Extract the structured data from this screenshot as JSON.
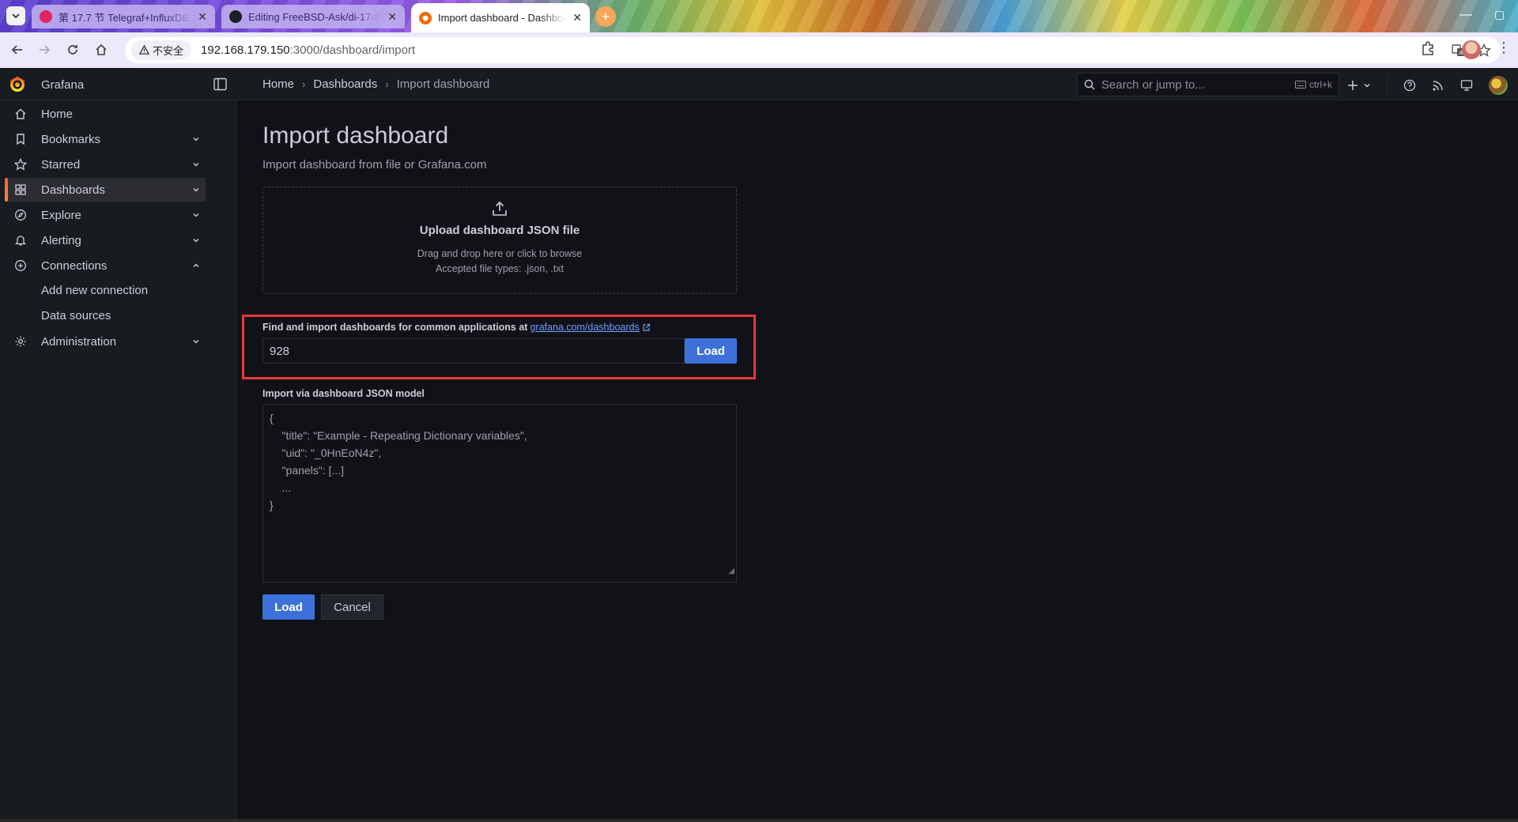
{
  "browser": {
    "tabs": [
      {
        "title": "第 17.7 节 Telegraf+InfluxDB",
        "favicon_color": "#e0245e"
      },
      {
        "title": "Editing FreeBSD-Ask/di-17-z",
        "favicon_color": "#1b1f23"
      },
      {
        "title": "Import dashboard - Dashboards",
        "favicon_color": "#f46800"
      }
    ],
    "new_tab": "+",
    "security_label": "不安全",
    "url_host": "192.168.179.150",
    "url_path": ":3000/dashboard/import"
  },
  "grafana": {
    "brand": "Grafana",
    "breadcrumb": [
      "Home",
      "Dashboards",
      "Import dashboard"
    ],
    "search_placeholder": "Search or jump to...",
    "search_shortcut": "ctrl+k",
    "nav": [
      {
        "label": "Home",
        "icon": "home-icon",
        "chevron": false
      },
      {
        "label": "Bookmarks",
        "icon": "bookmark-icon",
        "chevron": true
      },
      {
        "label": "Starred",
        "icon": "star-icon",
        "chevron": true
      },
      {
        "label": "Dashboards",
        "icon": "apps-icon",
        "chevron": true,
        "active": true
      },
      {
        "label": "Explore",
        "icon": "compass-icon",
        "chevron": true
      },
      {
        "label": "Alerting",
        "icon": "bell-icon",
        "chevron": true
      },
      {
        "label": "Connections",
        "icon": "connections-icon",
        "chevron": true,
        "expanded": true
      },
      {
        "label": "Administration",
        "icon": "gear-icon",
        "chevron": true
      }
    ],
    "nav_sub": [
      "Add new connection",
      "Data sources"
    ],
    "accent_color": "#f55f3e"
  },
  "page": {
    "title": "Import dashboard",
    "subtitle": "Import dashboard from file or Grafana.com",
    "upload": {
      "title": "Upload dashboard JSON file",
      "line1": "Drag and drop here or click to browse",
      "line2": "Accepted file types: .json, .txt"
    },
    "gcom": {
      "label": "Find and import dashboards for common applications at",
      "link": "grafana.com/dashboards",
      "value": "928",
      "load": "Load"
    },
    "json": {
      "label": "Import via dashboard JSON model",
      "placeholder": "{\n    \"title\": \"Example - Repeating Dictionary variables\",\n    \"uid\": \"_0HnEoN4z\",\n    \"panels\": [...]\n    ...\n}"
    },
    "actions": {
      "load": "Load",
      "cancel": "Cancel"
    },
    "highlight_color": "#e23a3a"
  }
}
